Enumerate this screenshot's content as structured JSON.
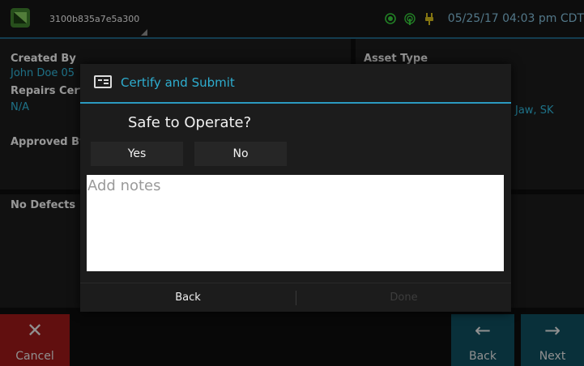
{
  "status_bar": {
    "device_id": "3100b835a7e5a300",
    "datetime": "05/25/17 04:03 pm CDT",
    "icons": [
      "gps-icon",
      "signal-icon",
      "power-plug-icon"
    ],
    "icon_color": "#35c43a",
    "plug_color": "#c9b21b"
  },
  "form": {
    "created_by_label": "Created By",
    "created_by_value": "John Doe 05",
    "repairs_label": "Repairs Cert",
    "repairs_value": "N/A",
    "approved_by_label": "Approved By",
    "asset_type_label": "Asset Type",
    "location_fragment": "Jaw, SK",
    "defects_label": "No Defects"
  },
  "nav": {
    "cancel_label": "Cancel",
    "back_label": "Back",
    "next_label": "Next"
  },
  "dialog": {
    "title": "Certify and Submit",
    "question": "Safe to Operate?",
    "yes_label": "Yes",
    "no_label": "No",
    "notes_placeholder": "Add notes",
    "back_label": "Back",
    "done_label": "Done",
    "accent_color": "#2eaed0"
  }
}
